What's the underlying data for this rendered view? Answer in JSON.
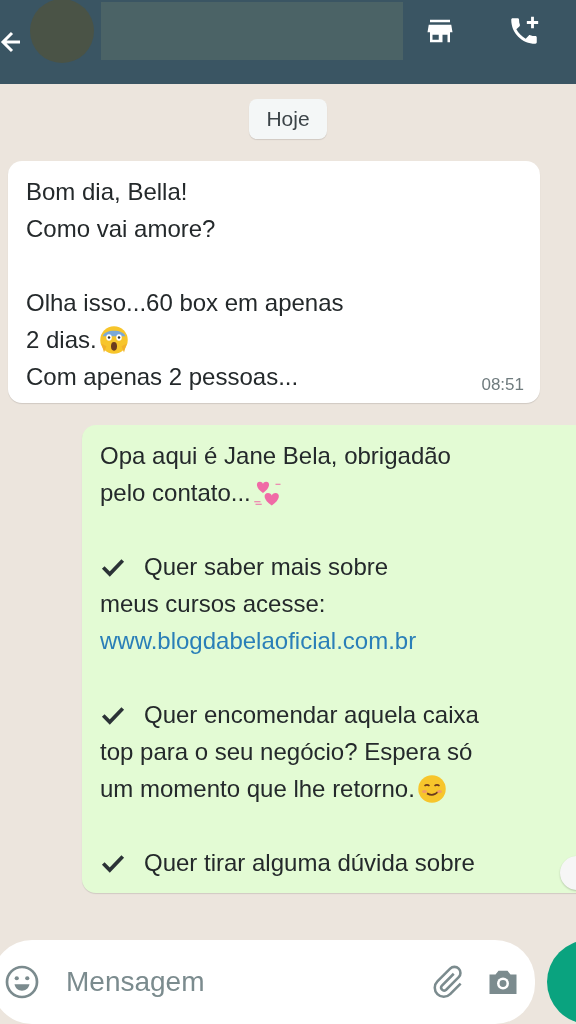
{
  "header": {
    "contact_name_redacted": true
  },
  "date_chip": "Hoje",
  "messages": [
    {
      "kind": "incoming",
      "time": "08:51",
      "paragraphs": [
        [
          [
            {
              "kind": "text",
              "text": "Bom dia, Bella!"
            }
          ],
          [
            {
              "kind": "text",
              "text": "Como vai amore?"
            }
          ]
        ],
        [
          [
            {
              "kind": "text",
              "text": "Olha isso...60 box em apenas"
            }
          ],
          [
            {
              "kind": "text",
              "text": "2 dias."
            },
            {
              "kind": "scream"
            }
          ],
          [
            {
              "kind": "text",
              "text": "Com apenas 2 pessoas..."
            }
          ]
        ]
      ]
    },
    {
      "kind": "outgoing",
      "paragraphs": [
        [
          [
            {
              "kind": "text",
              "text": "Opa aqui é Jane Bela, obrigadão"
            }
          ],
          [
            {
              "kind": "text",
              "text": "pelo contato..."
            },
            {
              "kind": "hearts"
            }
          ]
        ],
        [
          [
            {
              "kind": "check"
            },
            {
              "kind": "text",
              "text": "Quer saber mais sobre"
            }
          ],
          [
            {
              "kind": "text",
              "text": "meus cursos acesse:"
            }
          ],
          [
            {
              "kind": "link",
              "text": "www.blogdabelaoficial.com.br"
            }
          ]
        ],
        [
          [
            {
              "kind": "check"
            },
            {
              "kind": "text",
              "text": "Quer encomendar aquela caixa"
            }
          ],
          [
            {
              "kind": "text",
              "text": "top para o seu negócio? Espera só"
            }
          ],
          [
            {
              "kind": "text",
              "text": "um momento que lhe retorno."
            },
            {
              "kind": "smile"
            }
          ]
        ],
        [
          [
            {
              "kind": "check"
            },
            {
              "kind": "text",
              "text": "Quer tirar alguma dúvida sobre"
            }
          ]
        ]
      ]
    }
  ],
  "composer": {
    "placeholder": "Mensagem"
  }
}
